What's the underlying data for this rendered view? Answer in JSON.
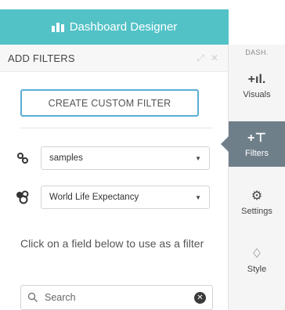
{
  "header": {
    "title": "Dashboard Designer",
    "icon": "dashboard-icon"
  },
  "panel": {
    "title": "ADD FILTERS",
    "expand_icon": "expand-icon",
    "close_icon": "close-icon",
    "create_button": "CREATE CUSTOM FILTER",
    "data_source": {
      "value": "samples",
      "icon": "link-icon"
    },
    "dataset": {
      "value": "World Life Expectancy",
      "icon": "dataset-icon"
    },
    "help_text": "Click on a field below to use as a filter",
    "search": {
      "placeholder": "Search",
      "icon": "search-icon",
      "clear_icon": "clear-icon"
    }
  },
  "nav": {
    "top_label": "DASH.",
    "items": [
      {
        "label": "Visuals",
        "icon": "+ıl."
      },
      {
        "label": "Filters",
        "icon": "+⊤"
      },
      {
        "label": "Settings",
        "icon": "⚙"
      },
      {
        "label": "Style",
        "icon": "♢"
      }
    ],
    "active": "Filters"
  },
  "colors": {
    "header": "#52c2c7",
    "accent_border": "#5aaed3",
    "active_nav": "#6f7f8a"
  }
}
